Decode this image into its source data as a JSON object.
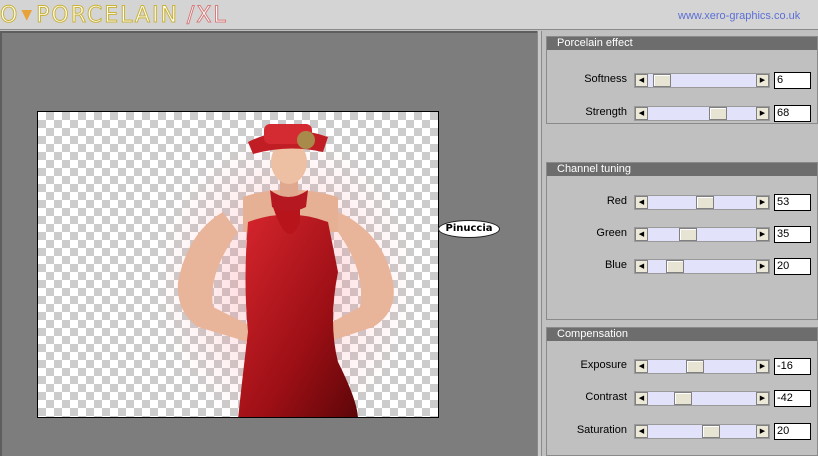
{
  "header": {
    "logo_text": "O",
    "logo_main": "PORCELAIN",
    "logo_suffix": "/XL",
    "site_link": "www.xero-graphics.co.uk"
  },
  "preview": {
    "watermark_text": "Pinuccia"
  },
  "panels": [
    {
      "title": "Porcelain effect",
      "controls": [
        {
          "label": "Softness",
          "value": "6",
          "slider_fraction": 0.06
        },
        {
          "label": "Strength",
          "value": "68",
          "slider_fraction": 0.68
        }
      ]
    },
    {
      "title": "Channel tuning",
      "controls": [
        {
          "label": "Red",
          "value": "53",
          "slider_fraction": 0.53
        },
        {
          "label": "Green",
          "value": "35",
          "slider_fraction": 0.35
        },
        {
          "label": "Blue",
          "value": "20",
          "slider_fraction": 0.2
        }
      ]
    },
    {
      "title": "Compensation",
      "controls": [
        {
          "label": "Exposure",
          "value": "-16",
          "slider_fraction": 0.42
        },
        {
          "label": "Contrast",
          "value": "-42",
          "slider_fraction": 0.29
        },
        {
          "label": "Saturation",
          "value": "20",
          "slider_fraction": 0.6
        }
      ]
    }
  ],
  "colors": {
    "panel_header": "#6d6d6d",
    "slider_track": "#e2e2fb",
    "preview_background": "#7d7d7d",
    "link": "#5c6fd6"
  },
  "icons": {
    "slider_left": "left-arrow-icon",
    "slider_right": "right-arrow-icon"
  }
}
